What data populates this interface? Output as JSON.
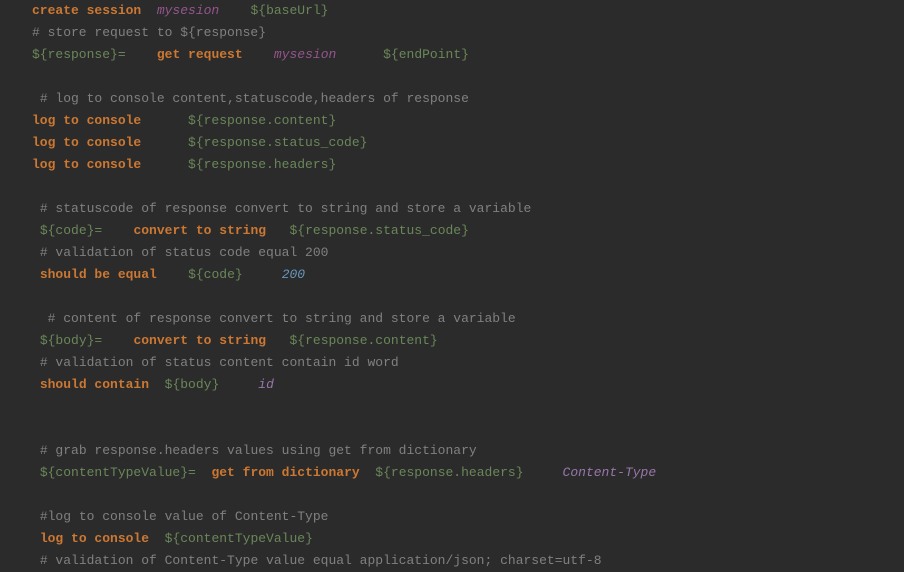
{
  "lines": [
    {
      "id": 0,
      "t": [
        {
          "c": "kw",
          "v": "create session"
        },
        {
          "c": "",
          "v": "  "
        },
        {
          "c": "var",
          "v": "mysesion"
        },
        {
          "c": "",
          "v": "    "
        },
        {
          "c": "str",
          "v": "${baseUrl}"
        }
      ]
    },
    {
      "id": 1,
      "t": [
        {
          "c": "comment",
          "v": "# store request to ${response}"
        }
      ]
    },
    {
      "id": 2,
      "t": [
        {
          "c": "str",
          "v": "${response}="
        },
        {
          "c": "",
          "v": "    "
        },
        {
          "c": "kw",
          "v": "get request"
        },
        {
          "c": "",
          "v": "    "
        },
        {
          "c": "var",
          "v": "mysesion"
        },
        {
          "c": "",
          "v": "      "
        },
        {
          "c": "str",
          "v": "${endPoint}"
        }
      ]
    },
    {
      "id": 3,
      "t": [
        {
          "c": "",
          "v": " "
        }
      ]
    },
    {
      "id": 4,
      "t": [
        {
          "c": "",
          "v": " "
        },
        {
          "c": "comment",
          "v": "# log to console content,statuscode,headers of response"
        }
      ]
    },
    {
      "id": 5,
      "t": [
        {
          "c": "kw",
          "v": "log to console"
        },
        {
          "c": "",
          "v": "      "
        },
        {
          "c": "str",
          "v": "${response.content}"
        }
      ]
    },
    {
      "id": 6,
      "t": [
        {
          "c": "kw",
          "v": "log to console"
        },
        {
          "c": "",
          "v": "      "
        },
        {
          "c": "str",
          "v": "${response.status_code}"
        }
      ]
    },
    {
      "id": 7,
      "t": [
        {
          "c": "kw",
          "v": "log to console"
        },
        {
          "c": "",
          "v": "      "
        },
        {
          "c": "str",
          "v": "${response.headers}"
        }
      ]
    },
    {
      "id": 8,
      "t": [
        {
          "c": "",
          "v": " "
        }
      ]
    },
    {
      "id": 9,
      "t": [
        {
          "c": "",
          "v": " "
        },
        {
          "c": "comment",
          "v": "# statuscode of response convert to string and store a variable"
        }
      ]
    },
    {
      "id": 10,
      "t": [
        {
          "c": "",
          "v": " "
        },
        {
          "c": "str",
          "v": "${code}="
        },
        {
          "c": "",
          "v": "    "
        },
        {
          "c": "kw",
          "v": "convert to string"
        },
        {
          "c": "",
          "v": "   "
        },
        {
          "c": "str",
          "v": "${response.status_code}"
        }
      ]
    },
    {
      "id": 11,
      "t": [
        {
          "c": "",
          "v": " "
        },
        {
          "c": "comment",
          "v": "# validation of status code equal 200"
        }
      ]
    },
    {
      "id": 12,
      "t": [
        {
          "c": "",
          "v": " "
        },
        {
          "c": "kw",
          "v": "should be equal"
        },
        {
          "c": "",
          "v": "    "
        },
        {
          "c": "str",
          "v": "${code}"
        },
        {
          "c": "",
          "v": "     "
        },
        {
          "c": "num",
          "v": "200"
        }
      ]
    },
    {
      "id": 13,
      "t": [
        {
          "c": "",
          "v": " "
        }
      ]
    },
    {
      "id": 14,
      "t": [
        {
          "c": "",
          "v": "  "
        },
        {
          "c": "comment",
          "v": "# content of response convert to string and store a variable"
        }
      ]
    },
    {
      "id": 15,
      "t": [
        {
          "c": "",
          "v": " "
        },
        {
          "c": "str",
          "v": "${body}="
        },
        {
          "c": "",
          "v": "    "
        },
        {
          "c": "kw",
          "v": "convert to string"
        },
        {
          "c": "",
          "v": "   "
        },
        {
          "c": "str",
          "v": "${response.content}"
        }
      ]
    },
    {
      "id": 16,
      "t": [
        {
          "c": "",
          "v": " "
        },
        {
          "c": "comment",
          "v": "# validation of status content contain id word"
        }
      ]
    },
    {
      "id": 17,
      "t": [
        {
          "c": "",
          "v": " "
        },
        {
          "c": "kw",
          "v": "should contain"
        },
        {
          "c": "",
          "v": "  "
        },
        {
          "c": "str",
          "v": "${body}"
        },
        {
          "c": "",
          "v": "     "
        },
        {
          "c": "ident",
          "v": "id"
        }
      ]
    },
    {
      "id": 18,
      "t": [
        {
          "c": "",
          "v": " "
        }
      ]
    },
    {
      "id": 19,
      "t": [
        {
          "c": "",
          "v": " "
        }
      ]
    },
    {
      "id": 20,
      "t": [
        {
          "c": "",
          "v": " "
        },
        {
          "c": "comment",
          "v": "# grab response.headers values using get from dictionary"
        }
      ]
    },
    {
      "id": 21,
      "t": [
        {
          "c": "",
          "v": " "
        },
        {
          "c": "str",
          "v": "${contentTypeValue}="
        },
        {
          "c": "",
          "v": "  "
        },
        {
          "c": "kw",
          "v": "get from dictionary"
        },
        {
          "c": "",
          "v": "  "
        },
        {
          "c": "str",
          "v": "${response.headers}"
        },
        {
          "c": "",
          "v": "     "
        },
        {
          "c": "ident",
          "v": "Content-Type"
        }
      ]
    },
    {
      "id": 22,
      "t": [
        {
          "c": "",
          "v": " "
        }
      ]
    },
    {
      "id": 23,
      "t": [
        {
          "c": "",
          "v": " "
        },
        {
          "c": "comment",
          "v": "#log to console value of Content-Type"
        }
      ]
    },
    {
      "id": 24,
      "t": [
        {
          "c": "",
          "v": " "
        },
        {
          "c": "kw",
          "v": "log to console"
        },
        {
          "c": "",
          "v": "  "
        },
        {
          "c": "str",
          "v": "${contentTypeValue}"
        }
      ]
    },
    {
      "id": 25,
      "t": [
        {
          "c": "",
          "v": " "
        },
        {
          "c": "comment",
          "v": "# validation of Content-Type value equal application/json; charset=utf-8"
        }
      ]
    }
  ]
}
